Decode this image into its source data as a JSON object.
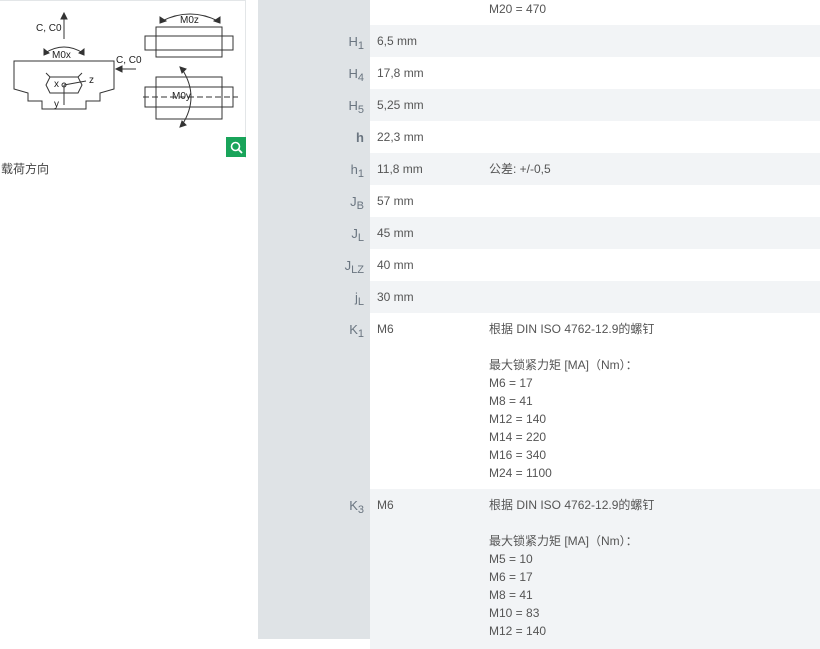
{
  "diagram": {
    "labels": {
      "c_c0_top": "C, C0",
      "m0x": "M0x",
      "c_c0_side": "C, C0",
      "m0z": "M0z",
      "m0y": "M0y",
      "x": "x",
      "y": "y",
      "z": "z"
    },
    "caption": "载荷方向",
    "zoom_icon": "magnifier-icon",
    "accent_color": "#19a45a"
  },
  "rows": [
    {
      "param": "",
      "sub": "",
      "value": "",
      "remark_lines": [
        "M20 = 470"
      ]
    },
    {
      "param": "H",
      "sub": "1",
      "value": "6,5  mm",
      "remark_lines": []
    },
    {
      "param": "H",
      "sub": "4",
      "value": "17,8  mm",
      "remark_lines": []
    },
    {
      "param": "H",
      "sub": "5",
      "value": "5,25  mm",
      "remark_lines": []
    },
    {
      "param": "h",
      "sub": "",
      "value": "22,3  mm",
      "remark_lines": []
    },
    {
      "param": "h",
      "sub": "1",
      "value": "11,8  mm",
      "remark_lines": [
        "公差: +/-0,5"
      ]
    },
    {
      "param": "J",
      "sub": "B",
      "value": "57  mm",
      "remark_lines": []
    },
    {
      "param": "J",
      "sub": "L",
      "value": "45  mm",
      "remark_lines": []
    },
    {
      "param": "J",
      "sub": "LZ",
      "value": "40  mm",
      "remark_lines": []
    },
    {
      "param": "j",
      "sub": "L",
      "value": "30  mm",
      "remark_lines": []
    },
    {
      "param": "K",
      "sub": "1",
      "value": "M6",
      "remark_lines": [
        "根据 DIN ISO 4762-12.9的螺钉",
        "",
        "最大锁紧力矩 [MA]（Nm）：",
        "M6 = 17",
        "M8 = 41",
        "M12 = 140",
        "M14 = 220",
        "M16 = 340",
        "M24 = 1100"
      ]
    },
    {
      "param": "K",
      "sub": "3",
      "value": "M6",
      "remark_lines": [
        "根据 DIN ISO 4762-12.9的螺钉",
        "",
        "最大锁紧力矩 [MA]（Nm）：",
        "M5 = 10",
        "M6 = 17",
        "M8 = 41",
        "M10 = 83",
        "M12 = 140"
      ]
    }
  ]
}
